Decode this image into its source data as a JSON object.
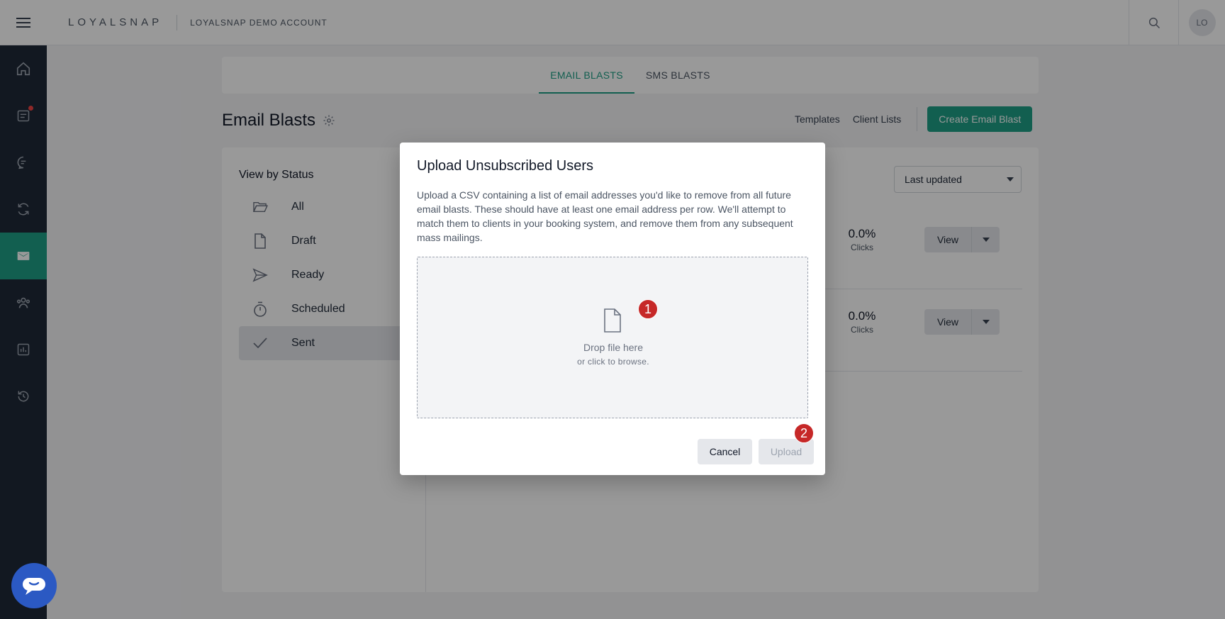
{
  "topbar": {
    "logo": "LOYALSNAP",
    "account": "LOYALSNAP DEMO ACCOUNT",
    "avatar_initials": "LO"
  },
  "sidebar": {
    "items": [
      {
        "icon": "home-icon"
      },
      {
        "icon": "calendar-icon",
        "notification": true
      },
      {
        "icon": "chat-icon"
      },
      {
        "icon": "refresh-icon"
      },
      {
        "icon": "mail-icon",
        "active": true
      },
      {
        "icon": "people-icon"
      },
      {
        "icon": "chart-icon"
      },
      {
        "icon": "history-icon"
      }
    ]
  },
  "tabs": [
    {
      "label": "EMAIL BLASTS",
      "active": true
    },
    {
      "label": "SMS BLASTS",
      "active": false
    }
  ],
  "page": {
    "title": "Email Blasts",
    "links": {
      "templates": "Templates",
      "client_lists": "Client Lists"
    },
    "create_button": "Create Email Blast"
  },
  "status_filter": {
    "title": "View by Status",
    "items": [
      {
        "label": "All",
        "icon": "folder-icon"
      },
      {
        "label": "Draft",
        "icon": "file-icon"
      },
      {
        "label": "Ready",
        "icon": "send-icon"
      },
      {
        "label": "Scheduled",
        "icon": "stopwatch-icon"
      },
      {
        "label": "Sent",
        "icon": "check-icon",
        "selected": true
      }
    ]
  },
  "list": {
    "sort_value": "Last updated",
    "rows": [
      {
        "clicks_value": "0.0%",
        "clicks_label": "Clicks",
        "view_label": "View"
      },
      {
        "clicks_value": "0.0%",
        "clicks_label": "Clicks",
        "view_label": "View"
      }
    ]
  },
  "modal": {
    "title": "Upload Unsubscribed Users",
    "description": "Upload a CSV containing a list of email addresses you'd like to remove from all future email blasts. These should have at least one email address per row. We'll attempt to match them to clients in your booking system, and remove them from any subsequent mass mailings.",
    "dropzone_main": "Drop file here",
    "dropzone_sub": "or click to browse.",
    "cancel_label": "Cancel",
    "upload_label": "Upload",
    "badges": [
      "1",
      "2"
    ]
  },
  "colors": {
    "accent": "#1f9e85",
    "sidebar_bg": "#1f2937",
    "badge": "#c62828",
    "chat": "#2b59c3"
  }
}
